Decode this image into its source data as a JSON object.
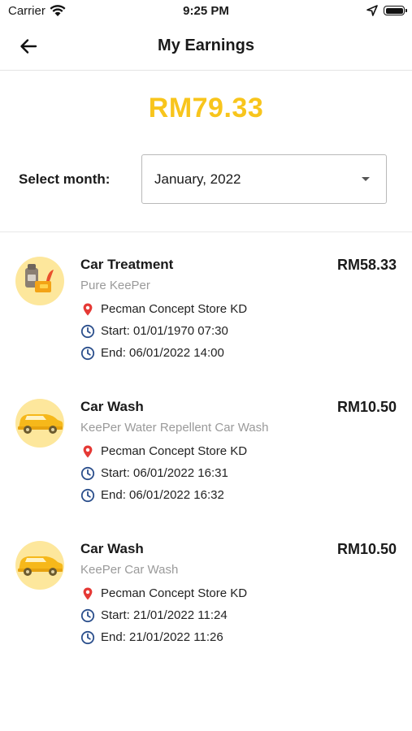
{
  "status_bar": {
    "carrier": "Carrier",
    "time": "9:25 PM"
  },
  "header": {
    "title": "My Earnings",
    "back_icon": "arrow-left-icon"
  },
  "summary": {
    "total": "RM79.33"
  },
  "month_filter": {
    "label": "Select month:",
    "value": "January, 2022"
  },
  "colors": {
    "accent": "#f8c51c",
    "avatar_bg": "#fde79c",
    "location": "#e53935",
    "clock": "#2b4f8c"
  },
  "earnings": [
    {
      "title": "Car Treatment",
      "subtitle": "Pure KeePer",
      "amount": "RM58.33",
      "location": "Pecman Concept Store KD",
      "start": "Start: 01/01/1970 07:30",
      "end": "End: 06/01/2022 14:00",
      "icon": "car-treatment-icon"
    },
    {
      "title": "Car Wash",
      "subtitle": "KeePer Water Repellent Car Wash",
      "amount": "RM10.50",
      "location": "Pecman Concept Store KD",
      "start": "Start: 06/01/2022 16:31",
      "end": "End: 06/01/2022 16:32",
      "icon": "car-wash-icon"
    },
    {
      "title": "Car Wash",
      "subtitle": "KeePer Car Wash",
      "amount": "RM10.50",
      "location": "Pecman Concept Store KD",
      "start": "Start: 21/01/2022 11:24",
      "end": "End: 21/01/2022 11:26",
      "icon": "car-wash-icon"
    }
  ]
}
